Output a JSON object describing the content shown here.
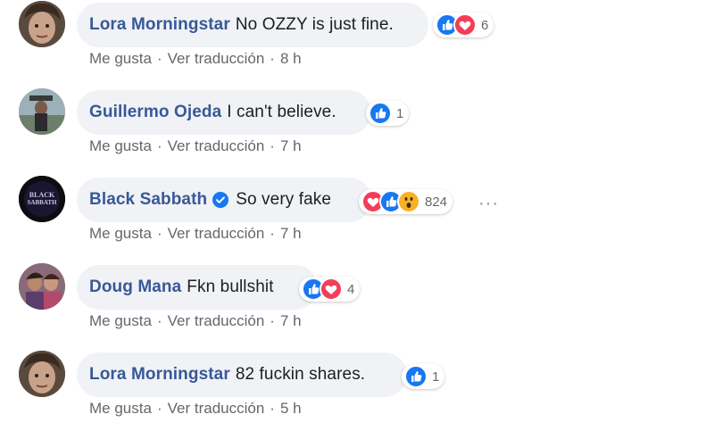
{
  "comments": [
    {
      "author": "Lora Morningstar",
      "text": "No OZZY is just fine.",
      "reaction_icons": [
        "like-icon",
        "love-icon"
      ],
      "reaction_count": "6",
      "actions": {
        "like": "Me gusta",
        "translate": "Ver traducción",
        "time": "8 h"
      },
      "verified": false
    },
    {
      "author": "Guillermo Ojeda",
      "text": "I can't believe.",
      "reaction_icons": [
        "like-icon"
      ],
      "reaction_count": "1",
      "actions": {
        "like": "Me gusta",
        "translate": "Ver traducción",
        "time": "7 h"
      },
      "verified": false
    },
    {
      "author": "Black Sabbath",
      "text": "So very fake",
      "reaction_icons": [
        "love-icon",
        "like-icon",
        "wow-icon"
      ],
      "reaction_count": "824",
      "actions": {
        "like": "Me gusta",
        "translate": "Ver traducción",
        "time": "7 h"
      },
      "verified": true,
      "avatar_text": "BLACK SABBATH"
    },
    {
      "author": "Doug Mana",
      "text": "Fkn bullshit",
      "reaction_icons": [
        "like-icon",
        "love-icon"
      ],
      "reaction_count": "4",
      "actions": {
        "like": "Me gusta",
        "translate": "Ver traducción",
        "time": "7 h"
      },
      "verified": false
    },
    {
      "author": "Lora Morningstar",
      "text": "82 fuckin shares.",
      "reaction_icons": [
        "like-icon"
      ],
      "reaction_count": "1",
      "actions": {
        "like": "Me gusta",
        "translate": "Ver traducción",
        "time": "5 h"
      },
      "verified": false
    }
  ],
  "more_options": "···",
  "separator": "·",
  "colors": {
    "author": "#385898",
    "bubble": "#f0f2f5",
    "meta": "#65676b",
    "like": "#1877f2",
    "love": "#f33e58",
    "wow": "#f7b125"
  }
}
